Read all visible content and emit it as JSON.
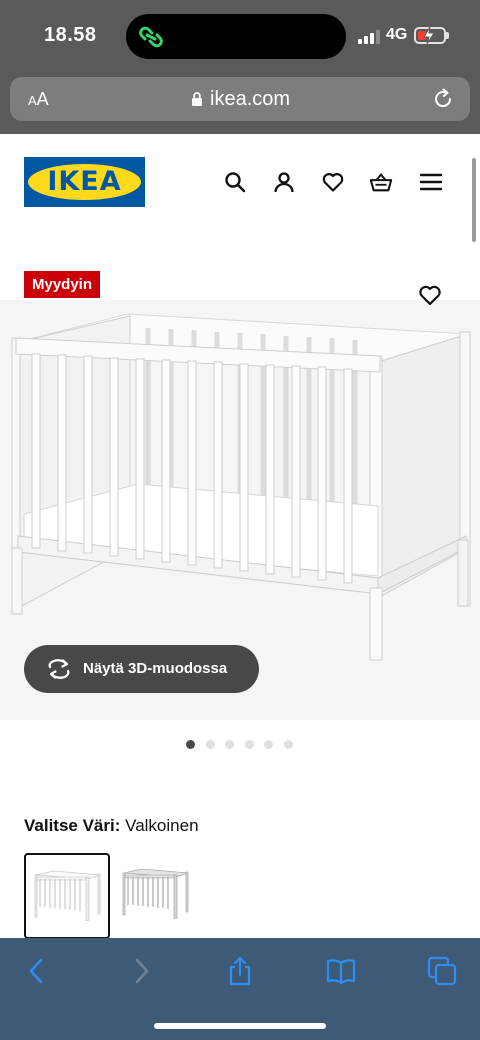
{
  "status_bar": {
    "time": "18.58",
    "network": "4G",
    "battery_color": "#ff3b30"
  },
  "browser": {
    "text_size_label_small": "A",
    "text_size_label_large": "A",
    "url": "ikea.com"
  },
  "site_header": {
    "logo_text": "IKEA",
    "logo_colors": {
      "blue": "#0058a3",
      "yellow": "#ffda1a"
    },
    "icons": [
      "search-icon",
      "account-icon",
      "favourites-icon",
      "shopping-bag-icon",
      "menu-icon"
    ]
  },
  "product": {
    "badge": "Myydyin",
    "badge_color": "#cc0008",
    "view_3d_label": "Näytä 3D-muodossa",
    "image_count": 6,
    "active_image_index": 0,
    "colour_label": "Valitse Väri:",
    "colour_value": "Valkoinen",
    "swatches": [
      {
        "name": "Valkoinen",
        "selected": true
      },
      {
        "name": "Harmaa",
        "selected": false
      }
    ]
  },
  "toolbar": {
    "icons": [
      "back-icon",
      "forward-icon",
      "share-icon",
      "bookmarks-icon",
      "tabs-icon"
    ],
    "accent": "#2b8ef0"
  }
}
